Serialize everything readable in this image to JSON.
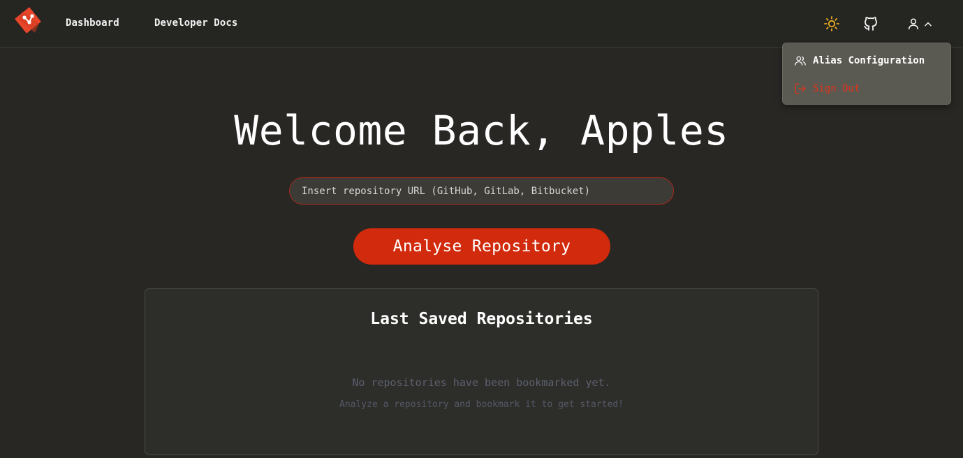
{
  "nav": {
    "links": [
      {
        "label": "Dashboard"
      },
      {
        "label": "Developer Docs"
      }
    ],
    "icons": {
      "logo": "git-logo-icon",
      "theme": "sun-icon",
      "github": "github-icon",
      "user": "user-icon",
      "chevron": "chevron-up-icon"
    }
  },
  "user_menu": {
    "items": [
      {
        "label": "Alias Configuration",
        "icon": "users-icon"
      },
      {
        "label": "Sign Out",
        "icon": "sign-out-icon"
      }
    ]
  },
  "hero": {
    "title": "Welcome Back, Apples",
    "input_placeholder": "Insert repository URL (GitHub, GitLab, Bitbucket)",
    "input_value": "",
    "button_label": "Analyse Repository"
  },
  "saved": {
    "title": "Last Saved Repositories",
    "empty_message": "No repositories have been bookmarked yet.",
    "empty_hint": "Analyze a repository and bookmark it to get started!"
  },
  "colors": {
    "background": "#282724",
    "accent": "#d12a0c",
    "sun": "#f0b020",
    "danger": "#e0341c"
  }
}
